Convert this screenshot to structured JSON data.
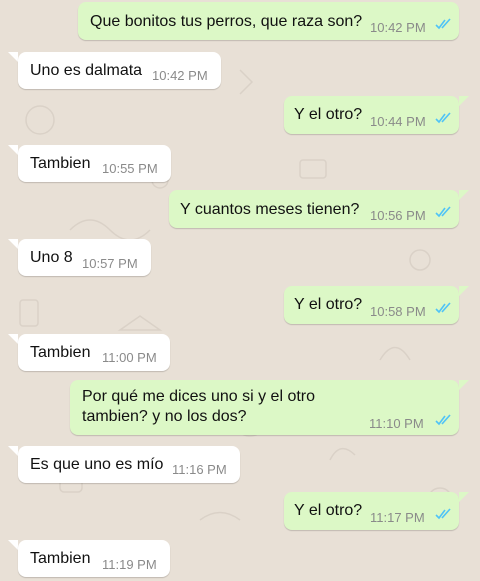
{
  "colors": {
    "outgoing_bubble": "#dcf8c6",
    "incoming_bubble": "#ffffff",
    "read_ticks": "#4fc3f7",
    "background": "#e8e0d6"
  },
  "messages": [
    {
      "direction": "out",
      "text": "Que bonitos tus perros, que raza son?",
      "time": "10:42 PM",
      "status": "read-ticks-icon"
    },
    {
      "direction": "in",
      "text": "Uno es dalmata",
      "time": "10:42 PM"
    },
    {
      "direction": "out",
      "text": "Y el otro?",
      "time": "10:44 PM",
      "status": "read-ticks-icon"
    },
    {
      "direction": "in",
      "text": "Tambien",
      "time": "10:55 PM"
    },
    {
      "direction": "out",
      "text": "Y cuantos meses tienen?",
      "time": "10:56 PM",
      "status": "read-ticks-icon"
    },
    {
      "direction": "in",
      "text": "Uno 8",
      "time": "10:57 PM"
    },
    {
      "direction": "out",
      "text": "Y el otro?",
      "time": "10:58 PM",
      "status": "read-ticks-icon"
    },
    {
      "direction": "in",
      "text": "Tambien",
      "time": "11:00 PM"
    },
    {
      "direction": "out",
      "text_line1": "Por qué me dices uno si y el otro",
      "text_line2": "tambien? y no los dos?",
      "time": "11:10 PM",
      "status": "read-ticks-icon"
    },
    {
      "direction": "in",
      "text": "Es que uno es mío",
      "time": "11:16 PM"
    },
    {
      "direction": "out",
      "text": "Y el otro?",
      "time": "11:17 PM",
      "status": "read-ticks-icon"
    },
    {
      "direction": "in",
      "text": "Tambien",
      "time": "11:19 PM"
    }
  ]
}
